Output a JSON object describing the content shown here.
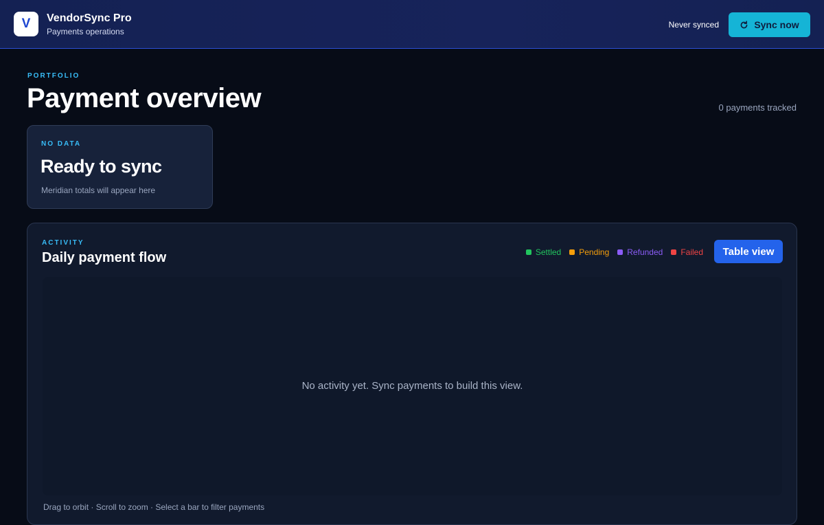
{
  "header": {
    "logo_letter": "V",
    "app_title": "VendorSync Pro",
    "app_subtitle": "Payments operations",
    "sync_status": "Never synced",
    "sync_button_label": "Sync now",
    "sync_button_icon": "refresh-icon"
  },
  "page": {
    "eyebrow": "PORTFOLIO",
    "title": "Payment overview",
    "tracked_count": "0 payments tracked"
  },
  "status_card": {
    "eyebrow": "NO DATA",
    "title": "Ready to sync",
    "subtitle": "Meridian totals will appear here"
  },
  "activity": {
    "eyebrow": "ACTIVITY",
    "title": "Daily payment flow",
    "legend": [
      {
        "label": "Settled",
        "color": "#22c55e"
      },
      {
        "label": "Pending",
        "color": "#f59e0b"
      },
      {
        "label": "Refunded",
        "color": "#8b5cf6"
      },
      {
        "label": "Failed",
        "color": "#ef4444"
      }
    ],
    "table_view_label": "Table view",
    "empty_message": "No activity yet. Sync payments to build this view.",
    "hint": "Drag to orbit · Scroll to zoom · Select a bar to filter payments"
  },
  "colors": {
    "accent_cyan": "#15b4d6",
    "primary_blue": "#2463eb",
    "eyebrow": "#38bdf8"
  }
}
